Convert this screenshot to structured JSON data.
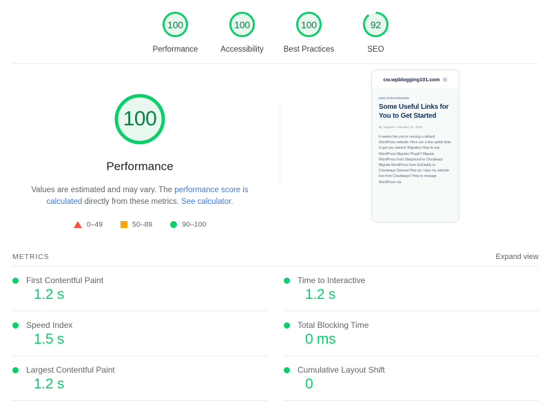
{
  "summary": {
    "scores": [
      {
        "value": "100",
        "label": "Performance",
        "pct": 100,
        "color": "#0cce6b"
      },
      {
        "value": "100",
        "label": "Accessibility",
        "pct": 100,
        "color": "#0cce6b"
      },
      {
        "value": "100",
        "label": "Best Practices",
        "pct": 100,
        "color": "#0cce6b"
      },
      {
        "value": "92",
        "label": "SEO",
        "pct": 92,
        "color": "#0cce6b"
      }
    ]
  },
  "hero": {
    "score": "100",
    "score_pct": 100,
    "title": "Performance",
    "desc_before": "Values are estimated and may vary. The ",
    "desc_link1": "performance score is calculated",
    "desc_middle": " directly from these metrics. ",
    "desc_link2": "See calculator.",
    "legend": [
      {
        "icon": "triangle-icon",
        "range": "0–49",
        "color": "#ff4e42"
      },
      {
        "icon": "square-icon",
        "range": "50–89",
        "color": "#ffa400"
      },
      {
        "icon": "circle-icon",
        "range": "90–100",
        "color": "#0cce6b"
      }
    ]
  },
  "thumbnail": {
    "url": "cw.wpblogging101.com",
    "menu_icon": "hamburger-icon",
    "category": "UNCATEGORIZED",
    "title": "Some Useful Links for You to Get Started",
    "byline": "By Inagesrt  •  January 14, 2023",
    "paragraph": "It seems like you're running a default WordPress website. Here are a few useful links to get you started: Migration How to use WordPress Migrator Plugin? Migrate WordPress from Siteground to Cloudways Migrate WordPress from GoDaddy to Cloudways General How do I take my website live from Cloudways? How to manage WordPress via"
  },
  "metrics": {
    "section_title": "METRICS",
    "expand_label": "Expand view",
    "items": [
      {
        "label": "First Contentful Paint",
        "value": "1.2 s",
        "status": "pass"
      },
      {
        "label": "Time to Interactive",
        "value": "1.2 s",
        "status": "pass"
      },
      {
        "label": "Speed Index",
        "value": "1.5 s",
        "status": "pass"
      },
      {
        "label": "Total Blocking Time",
        "value": "0 ms",
        "status": "pass"
      },
      {
        "label": "Largest Contentful Paint",
        "value": "1.2 s",
        "status": "pass"
      },
      {
        "label": "Cumulative Layout Shift",
        "value": "0",
        "status": "pass"
      }
    ]
  }
}
